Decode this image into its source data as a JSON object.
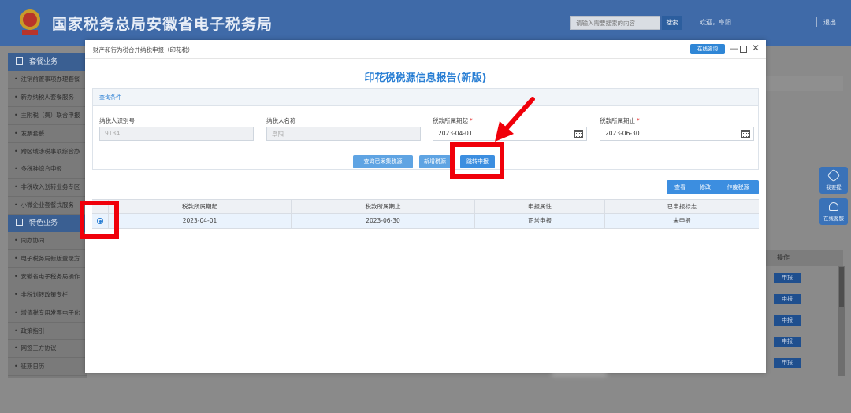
{
  "header": {
    "title": "国家税务总局安徽省电子税务局",
    "search_placeholder": "请输入需要搜索的内容",
    "search_button": "搜索",
    "welcome": "欢迎，阜阳",
    "logout": "退出"
  },
  "sidebar": {
    "groups": [
      {
        "label": "套餐业务",
        "items": [
          "注销前置事项办理套餐",
          "新办纳税人套餐服务",
          "主附税（费）联合申报",
          "发票套餐",
          "跨区域涉税事项综合办",
          "多税种综合申报",
          "非税收入划转业务专区",
          "小微企业套餐式服务"
        ]
      },
      {
        "label": "特色业务",
        "items": [
          "同办协同",
          "电子税务局新版登录方",
          "安徽省电子税务局操作",
          "非税划转政策专栏",
          "增值税专用发票电子化",
          "政策指引",
          "网签三方协议",
          "征期日历"
        ]
      }
    ]
  },
  "background": {
    "ops_header": "操作",
    "apply_label": "申报"
  },
  "float_buttons": {
    "feedback": "我要提",
    "online_service": "在线客服"
  },
  "modal": {
    "title": "财产和行为税合并纳税申报（印花税）",
    "online_consult": "在线咨询",
    "report_title": "印花税税源信息报告(新版)",
    "query_section": "查询条件",
    "fields": {
      "taxpayer_id": {
        "label": "纳税人识别号",
        "value": "9134"
      },
      "taxpayer_name": {
        "label": "纳税人名称",
        "value": "阜阳"
      },
      "period_start": {
        "label": "税款所属期起",
        "value": "2023-04-01"
      },
      "period_end": {
        "label": "税款所属期止",
        "value": "2023-06-30"
      }
    },
    "buttons": {
      "query_collected": "查询已采集税源",
      "add_source": "新增税源",
      "jump_declare": "跳转申报"
    },
    "actions": {
      "view": "查看",
      "modify": "修改",
      "void": "作废税源"
    },
    "table": {
      "headers": [
        "税款所属期起",
        "税款所属期止",
        "申报属性",
        "已申报标志"
      ],
      "rows": [
        {
          "selected": true,
          "cells": [
            "2023-04-01",
            "2023-06-30",
            "正常申报",
            "未申报"
          ]
        }
      ]
    }
  },
  "colors": {
    "header_bg": "#3f6aa8",
    "accent": "#2a7fd4",
    "highlight": "#f0000a"
  }
}
